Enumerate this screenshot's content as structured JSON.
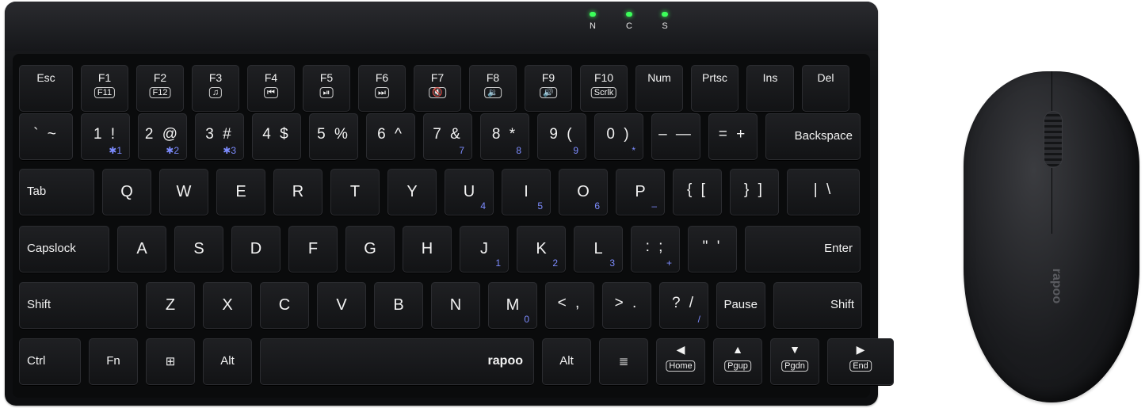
{
  "indicators": [
    "N",
    "C",
    "S"
  ],
  "colors": {
    "body": "#111214",
    "led": "#3cff5a",
    "legend": "#f2f2f2",
    "fn_legend": "#7d8cff"
  },
  "rows": {
    "r1": [
      {
        "top": "Esc"
      },
      {
        "top": "F1",
        "sub": "F11"
      },
      {
        "top": "F2",
        "sub": "F12"
      },
      {
        "top": "F3",
        "sub": "♫"
      },
      {
        "top": "F4",
        "sub": "⏮"
      },
      {
        "top": "F5",
        "sub": "⏯"
      },
      {
        "top": "F6",
        "sub": "⏭"
      },
      {
        "top": "F7",
        "sub": "🔇"
      },
      {
        "top": "F8",
        "sub": "🔉"
      },
      {
        "top": "F9",
        "sub": "🔊"
      },
      {
        "top": "F10",
        "sub": "Scrlk"
      },
      {
        "top": "Num"
      },
      {
        "top": "Prtsc"
      },
      {
        "top": "Ins"
      },
      {
        "top": "Del"
      }
    ],
    "r2": [
      {
        "main": "` ~"
      },
      {
        "main": "1 !",
        "fn": "✱1"
      },
      {
        "main": "2 @",
        "fn": "✱2"
      },
      {
        "main": "3 #",
        "fn": "✱3"
      },
      {
        "main": "4 $"
      },
      {
        "main": "5 %"
      },
      {
        "main": "6 ^"
      },
      {
        "main": "7 &",
        "fn": "7"
      },
      {
        "main": "8 *",
        "fn": "8"
      },
      {
        "main": "9 (",
        "fn": "9"
      },
      {
        "main": "0 )",
        "fn": "*"
      },
      {
        "main": "– —"
      },
      {
        "main": "= +"
      },
      {
        "label": "Backspace"
      }
    ],
    "r3": [
      {
        "label": "Tab"
      },
      {
        "main": "Q"
      },
      {
        "main": "W"
      },
      {
        "main": "E"
      },
      {
        "main": "R"
      },
      {
        "main": "T"
      },
      {
        "main": "Y"
      },
      {
        "main": "U",
        "fn": "4"
      },
      {
        "main": "I",
        "fn": "5"
      },
      {
        "main": "O",
        "fn": "6"
      },
      {
        "main": "P",
        "fn": "–"
      },
      {
        "main": "{ [",
        "fn": ""
      },
      {
        "main": "} ]"
      },
      {
        "main": "| \\"
      }
    ],
    "r4": [
      {
        "label": "Capslock"
      },
      {
        "main": "A"
      },
      {
        "main": "S"
      },
      {
        "main": "D"
      },
      {
        "main": "F"
      },
      {
        "main": "G"
      },
      {
        "main": "H"
      },
      {
        "main": "J",
        "fn": "1"
      },
      {
        "main": "K",
        "fn": "2"
      },
      {
        "main": "L",
        "fn": "3"
      },
      {
        "main": ": ;",
        "fn": "+"
      },
      {
        "main": "\" '"
      },
      {
        "label": "Enter"
      }
    ],
    "r5": [
      {
        "label": "Shift"
      },
      {
        "main": "Z"
      },
      {
        "main": "X"
      },
      {
        "main": "C"
      },
      {
        "main": "V"
      },
      {
        "main": "B"
      },
      {
        "main": "N"
      },
      {
        "main": "M",
        "fn": "0"
      },
      {
        "main": "< ,"
      },
      {
        "main": "> ."
      },
      {
        "main": "? /",
        "fn": "/"
      },
      {
        "label": "Pause"
      },
      {
        "label": "Shift"
      }
    ],
    "r6": [
      {
        "label": "Ctrl"
      },
      {
        "label": "Fn"
      },
      {
        "label": "⊞"
      },
      {
        "label": "Alt"
      },
      {
        "label": "rapoo"
      },
      {
        "label": "Alt"
      },
      {
        "label": "≣"
      },
      {
        "main": "◀",
        "sub": "Home"
      },
      {
        "main": "▲",
        "sub": "Pgup"
      },
      {
        "main": "▼",
        "sub": "Pgdn"
      },
      {
        "main": "▶",
        "sub": "End"
      }
    ]
  },
  "mouse": {
    "logo": "rapoo"
  }
}
